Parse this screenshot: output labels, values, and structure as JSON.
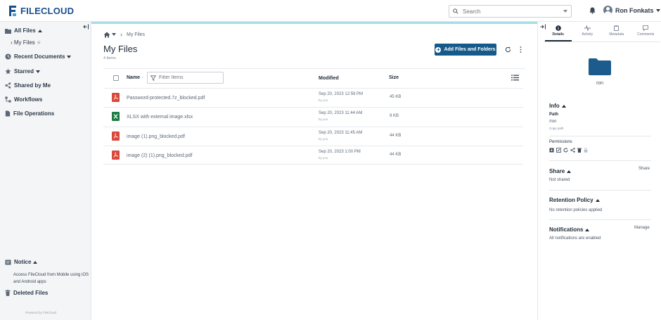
{
  "app": {
    "name": "FILECLOUD"
  },
  "header": {
    "search_placeholder": "Search",
    "user_name": "Ron Fonkats"
  },
  "sidebar": {
    "all_files": "All Files",
    "my_files": "My Files",
    "recent_documents": "Recent Documents",
    "starred": "Starred",
    "shared_by_me": "Shared by Me",
    "workflows": "Workflows",
    "file_operations": "File Operations",
    "notice_title": "Notice",
    "notice_text": "Access FileCloud from Mobile using iOS and Android apps",
    "deleted_files": "Deleted Files",
    "powered_by": "Powered by FileCloud"
  },
  "main": {
    "breadcrumb_current": "My Files",
    "title": "My Files",
    "item_count": "4 items",
    "add_button": "Add Files and Folders",
    "columns": {
      "name": "Name",
      "modified": "Modified",
      "size": "Size"
    },
    "filter_placeholder": "Filter Items",
    "files": [
      {
        "name": "Password-protected.7z_blocked.pdf",
        "type": "pdf",
        "date": "Sep 20, 2023 12:59 PM",
        "by": "by you",
        "size": "45 KB"
      },
      {
        "name": "XLSX with external image.xlsx",
        "type": "xlsx",
        "date": "Sep 20, 2023 11:44 AM",
        "by": "by you",
        "size": "9 KB"
      },
      {
        "name": "image (1).png_blocked.pdf",
        "type": "pdf",
        "date": "Sep 20, 2023 11:45 AM",
        "by": "by you",
        "size": "44 KB"
      },
      {
        "name": "image (2) (1).png_blocked.pdf",
        "type": "pdf",
        "date": "Sep 20, 2023 1:00 PM",
        "by": "by you",
        "size": "44 KB"
      }
    ]
  },
  "right_panel": {
    "tabs": [
      "Details",
      "Activity",
      "Metadata",
      "Comments"
    ],
    "folder_name": "ron",
    "info_title": "Info",
    "path_label": "Path",
    "path_value": "/ron",
    "copy_path": "Copy path",
    "permissions_label": "Permissions",
    "share_title": "Share",
    "share_link": "Share",
    "share_status": "Not shared",
    "retention_title": "Retention Policy",
    "retention_text": "No retention policies applied",
    "notifications_title": "Notifications",
    "manage_link": "Manage",
    "notifications_text": "All notifications are enabled"
  },
  "colors": {
    "brand": "#1a4f8b",
    "button": "#155a8a",
    "accent_bar": "#a6dde7",
    "folder": "#1c5c8c",
    "pdf": "#d9483b",
    "xlsx": "#1f7a44"
  }
}
